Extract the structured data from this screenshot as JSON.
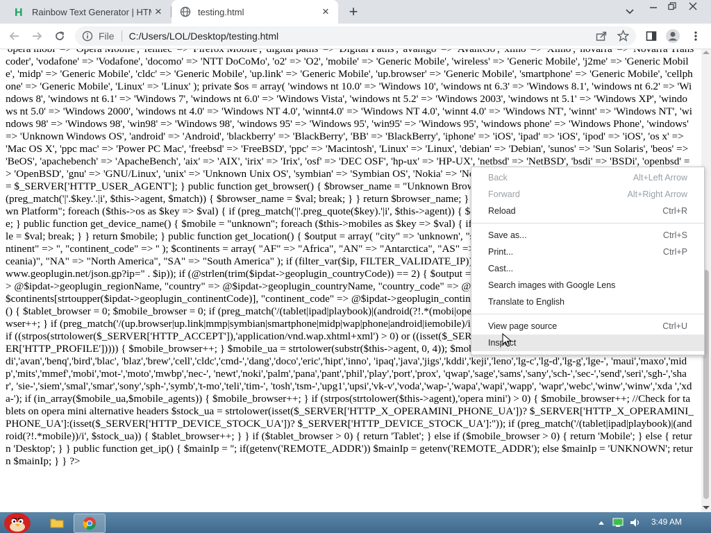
{
  "tabs": [
    {
      "title": "Rainbow Text Generator | HTML",
      "icon": "h-favicon-icon"
    },
    {
      "title": "testing.html",
      "icon": "globe-icon"
    }
  ],
  "toolbar": {
    "omnibox_prefix": "File",
    "url": "C:/Users/LOL/Desktop/testing.html"
  },
  "page_text": "'opera mobi' => 'Opera Mobile', 'fennec' => 'Firefox Mobile', 'digital paths' => 'Digital Paths', 'avantgo' => 'AvantGo', 'xiino' => 'Xiino', 'novarra' => 'Novarra Transcoder', 'vodafone' => 'Vodafone', 'docomo' => 'NTT DoCoMo', 'o2' => 'O2', 'mobile' => 'Generic Mobile', 'wireless' => 'Generic Mobile', 'j2me' => 'Generic Mobile', 'midp' => 'Generic Mobile', 'cldc' => 'Generic Mobile', 'up.link' => 'Generic Mobile', 'up.browser' => 'Generic Mobile', 'smartphone' => 'Generic Mobile', 'cellphone' => 'Generic Mobile', 'Linux' => 'Linux' ); private $os = array( 'windows nt 10.0' => 'Windows 10', 'windows nt 6.3' => 'Windows 8.1', 'windows nt 6.2' => 'Windows 8', 'windows nt 6.1' => 'Windows 7', 'windows nt 6.0' => 'Windows Vista', 'windows nt 5.2' => 'Windows 2003', 'windows nt 5.1' => 'Windows XP', 'windows nt 5.0' => 'Windows 2000', 'windows nt 4.0' => 'Windows NT 4.0', 'winnt4.0' => 'Windows NT 4.0', 'winnt 4.0' => 'Windows NT', 'winnt' => 'Windows NT', 'windows 98' => 'Windows 98', 'win98' => 'Windows 98', 'windows 95' => 'Windows 95', 'win95' => 'Windows 95', 'windows phone' => 'Windows Phone', 'windows' => 'Unknown Windows OS', 'android' => 'Android', 'blackberry' => 'BlackBerry', 'BB' => 'BlackBerry', 'iphone' => 'iOS', 'ipad' => 'iOS', 'ipod' => 'iOS', 'os x' => 'Mac OS X', 'ppc mac' => 'Power PC Mac', 'freebsd' => 'FreeBSD', 'ppc' => 'Macintosh', 'Linux' => 'Linux', 'debian' => 'Debian', 'sunos' => 'Sun Solaris', 'beos' => 'BeOS', 'apachebench' => 'ApacheBench', 'aix' => 'AIX', 'irix' => 'Irix', 'osf' => 'DEC OSF', 'hp-ux' => 'HP-UX', 'netbsd' => 'NetBSD', 'bsdi' => 'BSDi', 'openbsd' => 'OpenBSD', 'gnu' => 'GNU/Linux', 'unix' => 'Unknown Unix OS', 'symbian' => 'Symbian OS', 'Nokia' => 'Nokia Mobile', ); function __construct() { $this->agent = $_SERVER['HTTP_USER_AGENT']; } public function get_browser() { $browser_name = \"Unknown Browser\"; foreach ($this->browsers as $key => $val) { if (preg_match('|'.$key.'.|i', $this->agent, $match)) { $browser_name = $val; break; } } return $browser_name; } public function get_os() { $device_name = \"Unknown Platform\"; foreach ($this->os as $key => $val) { if (preg_match('|'.preg_quote($key).'|i', $this->agent)) { $device_name = $val; break; } } return $device_name; } public function get_device_name() { $mobile = \"unknown\"; foreach ($this->mobiles as $key => $val) { if (FALSE !== (stripos($this->agent, $key))) { $mobile = $val; break; } } return $mobile; } public function get_location() { $output = array( \"city\" => 'unknown', \"state\" => '', \"country\" => '', \"country_code\" => '', \"continent\" => '', \"continent_code\" => '' ); $continents = array( \"AF\" => \"Africa\", \"AN\" => \"Antarctica\", \"AS\" => \"Asia\", \"EU\" => \"Europe\", \"OC\" => \"Australia (Oceania)\", \"NA\" => \"North America\", \"SA\" => \"South America\" ); if (filter_var($ip, FILTER_VALIDATE_IP)) { $ipdat = @json_decode(file_get_contents(\"http://www.geoplugin.net/json.gp?ip=\" . $ip)); if (@strlen(trim($ipdat->geoplugin_countryCode)) == 2) { $output = array( \"city\" => @$ipdat->geoplugin_city, \"state\" => @$ipdat->geoplugin_regionName, \"country\" => @$ipdat->geoplugin_countryName, \"country_code\" => @$ipdat->geoplugin_countryCode, \"continent\" => @$continents[strtoupper($ipdat->geoplugin_continentCode)], \"continent_code\" => @$ipdat->geoplugin_continentCode ); } } return $output; } function get_device() { $tablet_browser = 0; $mobile_browser = 0; if (preg_match('/(tablet|ipad|playbook)|(android(?!.*(mobi|opera mini)))/i', strtolower($this->agent))) { $tablet_browser++; } if (preg_match('/(up.browser|up.link|mmp|symbian|smartphone|midp|wap|phone|android|iemobile)/i', strtolower($this->agent))) { $mobile_browser++; } if ((strpos(strtolower($_SERVER['HTTP_ACCEPT']),'application/vnd.wap.xhtml+xml') > 0) or ((isset($_SERVER['HTTP_X_WAP_PROFILE']) or isset($_SERVER['HTTP_PROFILE'])))) { $mobile_browser++; } $mobile_ua = strtolower(substr($this->agent, 0, 4)); $mobile_agents = array( 'w3c ','acs-','alav','alca','amoi','audi','avan','benq','bird','blac', 'blaz','brew','cell','cldc','cmd-','dang','doco','eric','hipt','inno', 'ipaq','java','jigs','kddi','keji','leno','lg-c','lg-d','lg-g','lge-', 'maui','maxo','midp','mits','mmef','mobi','mot-','moto','mwbp','nec-', 'newt','noki','palm','pana','pant','phil','play','port','prox', 'qwap','sage','sams','sany','sch-','sec-','send','seri','sgh-','shar', 'sie-','siem','smal','smar','sony','sph-','symb','t-mo','teli','tim-', 'tosh','tsm-','upg1','upsi','vk-v','voda','wap-','wapa','wapi','wapp', 'wapr','webc','winw','winw','xda ','xda-'); if (in_array($mobile_ua,$mobile_agents)) { $mobile_browser++; } if (strpos(strtolower($this->agent),'opera mini') > 0) { $mobile_browser++; //Check for tablets on opera mini alternative headers $stock_ua = strtolower(isset($_SERVER['HTTP_X_OPERAMINI_PHONE_UA'])? $_SERVER['HTTP_X_OPERAMINI_PHONE_UA']:(isset($_SERVER['HTTP_DEVICE_STOCK_UA'])? $_SERVER['HTTP_DEVICE_STOCK_UA']:'')); if (preg_match('/(tablet|ipad|playbook)|(android(?!.*mobile))/i', $stock_ua)) { $tablet_browser++; } } if ($tablet_browser > 0) { return 'Tablet'; } else if ($mobile_browser > 0) { return 'Mobile'; } else { return 'Desktop'; } } public function get_ip() { $mainIp = ''; if(getenv('REMOTE_ADDR')) $mainIp = getenv('REMOTE_ADDR'); else $mainIp = 'UNKNOWN'; return $mainIp; } } ?>",
  "context_menu": {
    "items": [
      {
        "label": "Back",
        "shortcut": "Alt+Left Arrow",
        "disabled": true
      },
      {
        "label": "Forward",
        "shortcut": "Alt+Right Arrow",
        "disabled": true
      },
      {
        "label": "Reload",
        "shortcut": "Ctrl+R",
        "disabled": false
      },
      {
        "label": "Save as...",
        "shortcut": "Ctrl+S",
        "disabled": false
      },
      {
        "label": "Print...",
        "shortcut": "Ctrl+P",
        "disabled": false
      },
      {
        "label": "Cast...",
        "shortcut": "",
        "disabled": false
      },
      {
        "label": "Search images with Google Lens",
        "shortcut": "",
        "disabled": false
      },
      {
        "label": "Translate to English",
        "shortcut": "",
        "disabled": false
      },
      {
        "label": "View page source",
        "shortcut": "Ctrl+U",
        "disabled": false
      },
      {
        "label": "Inspect",
        "shortcut": "",
        "disabled": false
      }
    ]
  },
  "taskbar": {
    "clock": "3:49 AM"
  },
  "colors": {
    "tab_strip": "#dee1e6",
    "h_favicon": "#1aa260",
    "taskbar": "#4a7496",
    "menu_hover": "#e8e8e8"
  }
}
